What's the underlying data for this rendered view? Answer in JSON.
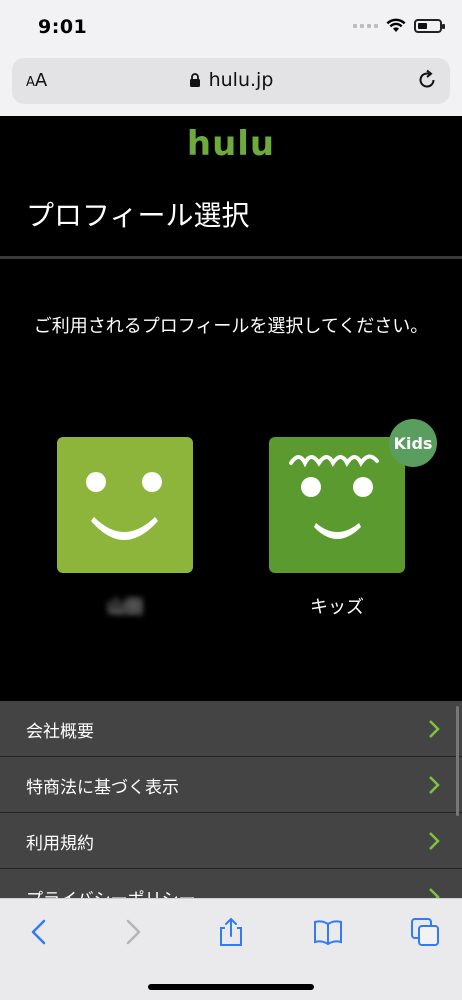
{
  "status_bar": {
    "time": "9:01"
  },
  "address_bar": {
    "text_size_label_small": "A",
    "text_size_label_large": "A",
    "url": "hulu.jp"
  },
  "page": {
    "logo": "hulu",
    "title": "プロフィール選択",
    "instruction": "ご利用されるプロフィールを選択してください。",
    "profiles": [
      {
        "name": "山田",
        "type": "main",
        "color": "#8db53b"
      },
      {
        "name": "キッズ",
        "type": "kids",
        "badge": "Kids",
        "color": "#5a9a2e"
      }
    ],
    "footer_links": [
      {
        "label": "会社概要"
      },
      {
        "label": "特商法に基づく表示"
      },
      {
        "label": "利用規約"
      },
      {
        "label": "プライバシーポリシー"
      }
    ]
  },
  "colors": {
    "brand_green": "#6cab3c",
    "link_chevron": "#7fc241",
    "toolbar_blue": "#2f7cf6"
  }
}
